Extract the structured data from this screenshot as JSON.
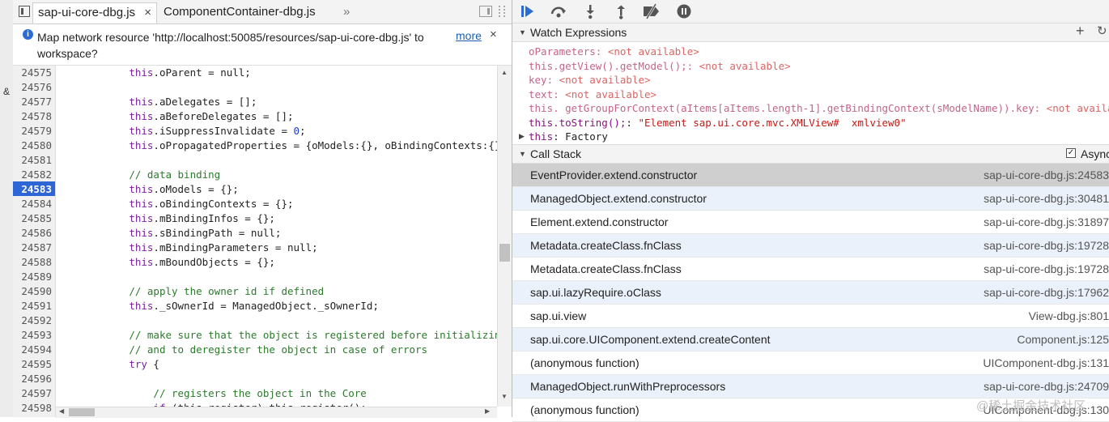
{
  "tabs": {
    "items": [
      {
        "label": "sap-ui-core-dbg.js",
        "close": "×"
      },
      {
        "label": "ComponentContainer-dbg.js"
      }
    ],
    "more": "»"
  },
  "infobar": {
    "message": "Map network resource 'http://localhost:50085/resources/sap-ui-core-dbg.js' to workspace?",
    "more_link": "more",
    "close": "×"
  },
  "editor": {
    "line_numbers": [
      "24575",
      "24576",
      "24577",
      "24578",
      "24579",
      "24580",
      "24581",
      "24582",
      "24583",
      "24584",
      "24585",
      "24586",
      "24587",
      "24588",
      "24589",
      "24590",
      "24591",
      "24592",
      "24593",
      "24594",
      "24595",
      "24596",
      "24597",
      "24598"
    ],
    "current_line": "24583",
    "left_strip_char": "&"
  },
  "watch": {
    "title": "Watch Expressions",
    "add": "+",
    "refresh": "↻",
    "rows": [
      {
        "name": "oParameters",
        "sep": ": ",
        "value": "<not available>"
      },
      {
        "name": "this.getView().getModel();",
        "sep": ": ",
        "value": "<not available>"
      },
      {
        "name": "key",
        "sep": ": ",
        "value": "<not available>"
      },
      {
        "name": "text",
        "sep": ": ",
        "value": "<not available>"
      },
      {
        "name": "this. getGroupForContext(aItems[aItems.length-1].getBindingContext(sModelName)).key",
        "sep": ": ",
        "value": "<not available>"
      }
    ],
    "tostring_name": "this.toString();",
    "tostring_sep": ": ",
    "tostring_value": "\"Element sap.ui.core.mvc.XMLView#  xmlview0\"",
    "this_name": "this",
    "this_sep": ": ",
    "this_value": "Factory"
  },
  "callstack": {
    "title": "Call Stack",
    "async_label": "Async",
    "async_checked": true,
    "frames": [
      {
        "fn": "EventProvider.extend.constructor",
        "loc": "sap-ui-core-dbg.js:24583"
      },
      {
        "fn": "ManagedObject.extend.constructor",
        "loc": "sap-ui-core-dbg.js:30481"
      },
      {
        "fn": "Element.extend.constructor",
        "loc": "sap-ui-core-dbg.js:31897"
      },
      {
        "fn": "Metadata.createClass.fnClass",
        "loc": "sap-ui-core-dbg.js:19728"
      },
      {
        "fn": "Metadata.createClass.fnClass",
        "loc": "sap-ui-core-dbg.js:19728"
      },
      {
        "fn": "sap.ui.lazyRequire.oClass",
        "loc": "sap-ui-core-dbg.js:17962"
      },
      {
        "fn": "sap.ui.view",
        "loc": "View-dbg.js:801"
      },
      {
        "fn": "sap.ui.core.UIComponent.extend.createContent",
        "loc": "Component.js:125"
      },
      {
        "fn": "(anonymous function)",
        "loc": "UIComponent-dbg.js:131"
      },
      {
        "fn": "ManagedObject.runWithPreprocessors",
        "loc": "sap-ui-core-dbg.js:24709"
      },
      {
        "fn": "(anonymous function)",
        "loc": "UIComponent-dbg.js:130"
      }
    ]
  },
  "watermark": "@稀土掘金技术社区",
  "code_lines": [
    {
      "indent": "            ",
      "kw": "this",
      "rest": ".oParent = null;"
    },
    {
      "text": ""
    },
    {
      "indent": "            ",
      "kw": "this",
      "rest": ".aDelegates = [];"
    },
    {
      "indent": "            ",
      "kw": "this",
      "rest": ".aBeforeDelegates = [];"
    },
    {
      "indent": "            ",
      "kw": "this",
      "rest": ".iSuppressInvalidate = ",
      "num": "0",
      "tail": ";"
    },
    {
      "indent": "            ",
      "kw": "this",
      "rest": ".oPropagatedProperties = {oModels:{}, oBindingContexts:{}};"
    },
    {
      "text": ""
    },
    {
      "indent": "            ",
      "comment": "// data binding"
    },
    {
      "indent": "            ",
      "kw": "this",
      "rest": ".oModels = {};"
    },
    {
      "indent": "            ",
      "kw": "this",
      "rest": ".oBindingContexts = {};"
    },
    {
      "indent": "            ",
      "kw": "this",
      "rest": ".mBindingInfos = {};"
    },
    {
      "indent": "            ",
      "kw": "this",
      "rest": ".sBindingPath = null;"
    },
    {
      "indent": "            ",
      "kw": "this",
      "rest": ".mBindingParameters = null;"
    },
    {
      "indent": "            ",
      "kw": "this",
      "rest": ".mBoundObjects = {};"
    },
    {
      "text": ""
    },
    {
      "indent": "            ",
      "comment": "// apply the owner id if defined"
    },
    {
      "indent": "            ",
      "kw": "this",
      "rest": "._sOwnerId = ManagedObject._sOwnerId;"
    },
    {
      "text": ""
    },
    {
      "indent": "            ",
      "comment": "// make sure that the object is registered before initializing"
    },
    {
      "indent": "            ",
      "comment": "// and to deregister the object in case of errors"
    },
    {
      "indent": "            ",
      "kw": "try",
      "rest": " {"
    },
    {
      "text": ""
    },
    {
      "indent": "                ",
      "comment": "// registers the object in the Core"
    },
    {
      "indent": "                ",
      "kw": "if",
      "rest": " (this.register) this.register();"
    }
  ]
}
